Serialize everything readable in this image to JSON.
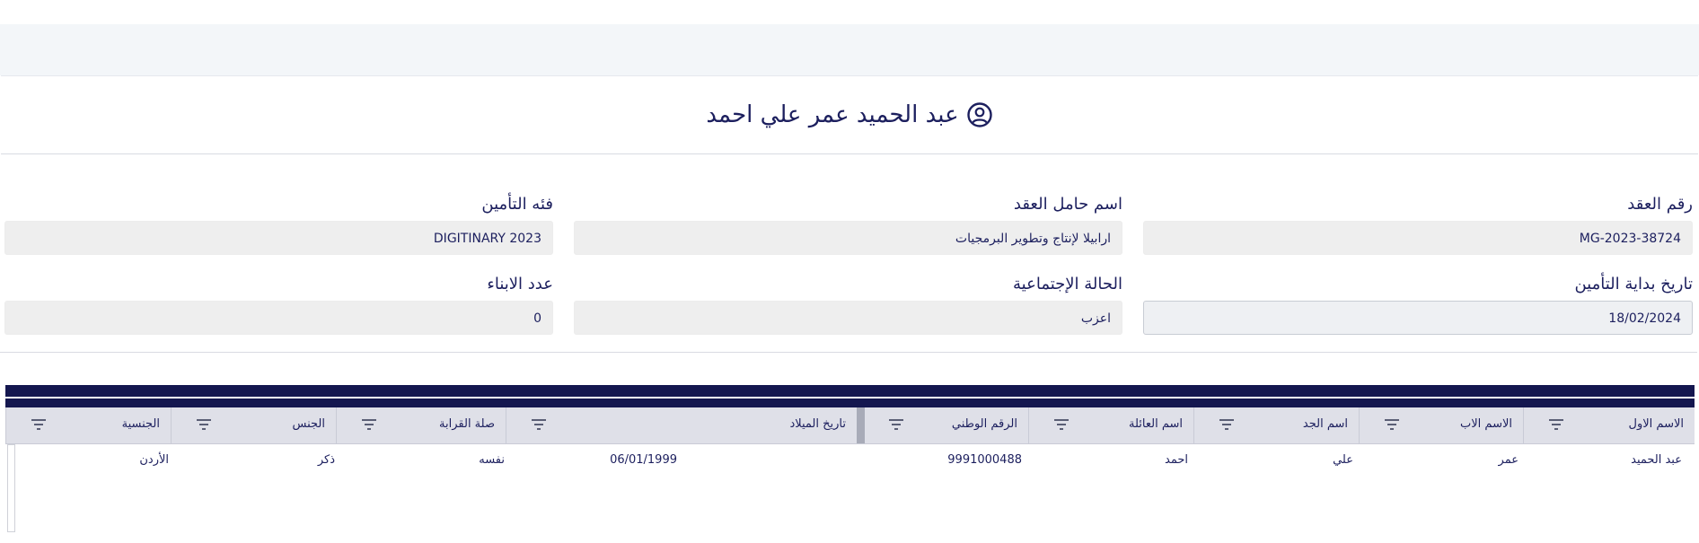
{
  "header": {
    "name": "عبد الحميد عمر علي احمد",
    "icon": "user-circle-icon"
  },
  "fields": {
    "contract_number": {
      "label": "رقم العقد",
      "value": "MG-2023-38724"
    },
    "contract_holder": {
      "label": "اسم حامل العقد",
      "value": "ارابيلا لإنتاج وتطوير البرمجيات"
    },
    "insurance_category": {
      "label": "فئه التأمين",
      "value": "DIGITINARY 2023"
    },
    "insurance_start": {
      "label": "تاريخ بداية التأمين",
      "value": "18/02/2024"
    },
    "marital_status": {
      "label": "الحالة الإجتماعية",
      "value": "اعزب"
    },
    "children_count": {
      "label": "عدد الابناء",
      "value": "0"
    }
  },
  "table": {
    "columns": [
      "الاسم الاول",
      "الاسم الاب",
      "اسم الجد",
      "اسم العائلة",
      "الرقم الوطني",
      "تاريخ الميلاد",
      "صلة القرابة",
      "الجنس",
      "الجنسية"
    ],
    "rows": [
      [
        "عبد الحميد",
        "عمر",
        "علي",
        "احمد",
        "9991000488",
        "06/01/1999",
        "نفسه",
        "ذكر",
        "الأردن"
      ]
    ]
  },
  "colors": {
    "primary": "#1c1f5e",
    "header_bar": "#14174f",
    "field_bg": "#eeeeee",
    "band_bg": "#f3f6f9"
  }
}
